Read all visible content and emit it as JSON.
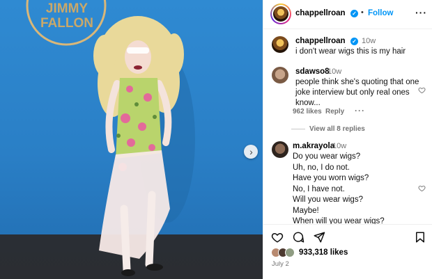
{
  "photo": {
    "sign_text": [
      "JIMMY",
      "FALLON"
    ],
    "next_icon": "chevron-right-icon"
  },
  "header": {
    "username": "chappellroan",
    "follow_label": "Follow",
    "separator": "•",
    "more_icon": "more-horizontal-icon"
  },
  "caption": {
    "username": "chappellroan",
    "time": "10w",
    "text": "i don't wear wigs this is my hair"
  },
  "comments": [
    {
      "username": "sdawso8",
      "time": "10w",
      "text": "people think she's quoting that one\njoke interview but only real ones\nknow...",
      "likes": "962 likes",
      "reply_label": "Reply",
      "view_replies": "View all 8 replies"
    },
    {
      "username": "m.akrayola",
      "time": "10w",
      "text": "Do you wear wigs?\nUh, no, I do not.\nHave you worn wigs?\nNo, I have not.\nWill you wear wigs?\nMaybe!\nWhen will you wear wigs?\n*bursts out in more laughter*"
    }
  ],
  "actions": {
    "like_icon": "heart-icon",
    "comment_icon": "comment-icon",
    "share_icon": "send-icon",
    "save_icon": "bookmark-icon"
  },
  "likes_count": "933,318 likes",
  "post_date": "July 2",
  "colors": {
    "link_blue": "#0095f6",
    "photo_bg": "#2a7fc6",
    "meta_gray": "#737373"
  }
}
